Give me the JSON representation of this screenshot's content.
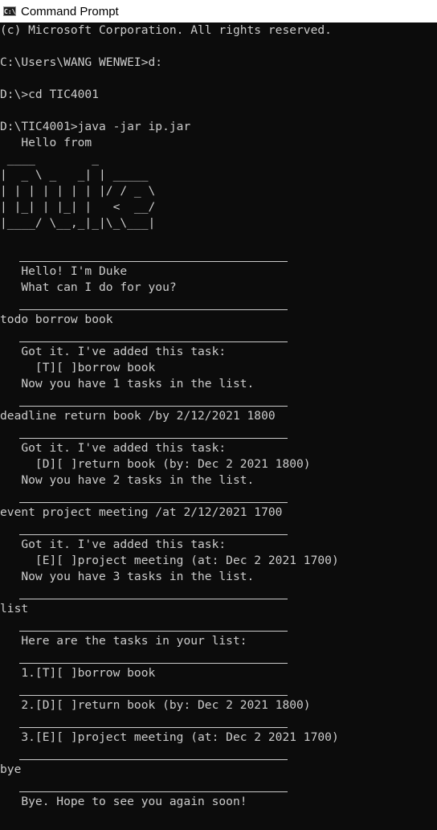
{
  "window": {
    "title": "Command Prompt",
    "icon": "cmd-icon",
    "icon_text": "C:\\."
  },
  "console": {
    "lines": [
      "(c) Microsoft Corporation. All rights reserved.",
      "",
      "C:\\Users\\WANG WENWEI>d:",
      "",
      "D:\\>cd TIC4001",
      "",
      "D:\\TIC4001>java -jar ip.jar",
      "   Hello from",
      " ____        _",
      "|  _ \\ _   _| | _____",
      "| | | | | | | |/ / _ \\",
      "| |_| | |_| |   <  __/",
      "|____/ \\__,_|_|\\_\\___|",
      "",
      "",
      "   Hello! I'm Duke",
      "   What can I do for you?",
      "",
      "todo borrow book",
      "",
      "   Got it. I've added this task:",
      "     [T][ ]borrow book",
      "   Now you have 1 tasks in the list.",
      "",
      "deadline return book /by 2/12/2021 1800",
      "",
      "   Got it. I've added this task:",
      "     [D][ ]return book (by: Dec 2 2021 1800)",
      "   Now you have 2 tasks in the list.",
      "",
      "event project meeting /at 2/12/2021 1700",
      "",
      "   Got it. I've added this task:",
      "     [E][ ]project meeting (at: Dec 2 2021 1700)",
      "   Now you have 3 tasks in the list.",
      "",
      "list",
      "",
      "   Here are the tasks in your list:",
      "",
      "   1.[T][ ]borrow book",
      "",
      "   2.[D][ ]return book (by: Dec 2 2021 1800)",
      "",
      "   3.[E][ ]project meeting (at: Dec 2 2021 1700)",
      "",
      "bye",
      "",
      "   Bye. Hope to see you again soon!"
    ],
    "separator_after_lines": [
      14,
      17,
      19,
      23,
      25,
      29,
      31,
      35,
      37,
      39,
      41,
      43,
      45,
      47
    ]
  },
  "colors": {
    "background": "#0c0c0c",
    "text": "#cccccc",
    "titlebar": "#ffffff"
  }
}
